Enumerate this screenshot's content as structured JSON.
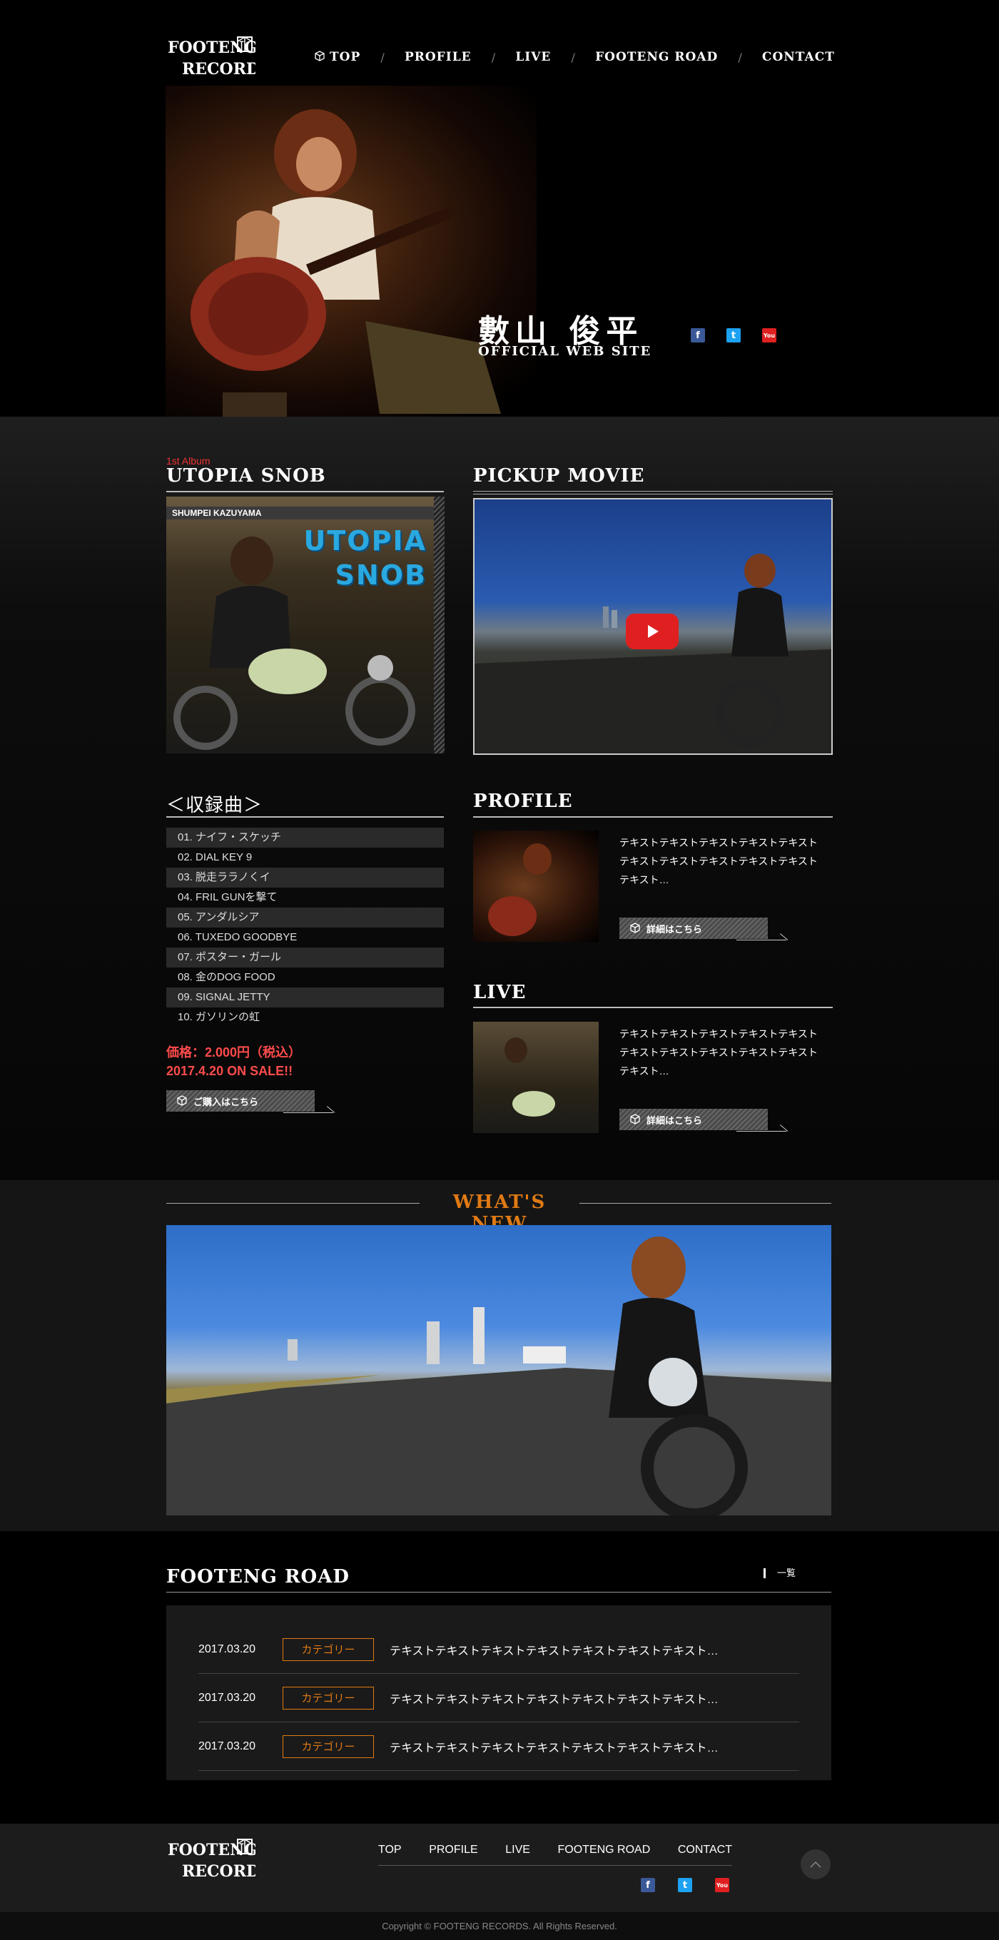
{
  "colors": {
    "accent_orange": "#e07a14",
    "price_red": "#ff4b4b",
    "album_tag_red": "#ee3333",
    "facebook": "#3b5998",
    "twitter": "#1da1f2",
    "youtube": "#e02020"
  },
  "header": {
    "logo_line1": "FOOTENG",
    "logo_line2": "RECORDS",
    "nav": [
      {
        "label": "TOP",
        "icon": "box-icon"
      },
      {
        "label": "PROFILE"
      },
      {
        "label": "LIVE"
      },
      {
        "label": "FOOTENG ROAD"
      },
      {
        "label": "CONTACT"
      }
    ],
    "separator": "/"
  },
  "hero": {
    "name": "數山 俊平",
    "subtitle": "OFFICIAL WEB SITE",
    "social": [
      {
        "name": "facebook-icon",
        "glyph": "f"
      },
      {
        "name": "twitter-icon",
        "glyph": "t"
      },
      {
        "name": "youtube-icon",
        "glyph": "You"
      }
    ]
  },
  "album": {
    "tag": "1st Album",
    "title": "UTOPIA SNOB",
    "cover_artist": "SHUMPEI KAZUYAMA",
    "cover_title_line1": "UTOPIA",
    "cover_title_line2": "SNOB",
    "tracklist_heading": "＜収録曲＞",
    "tracks": [
      "01. ナイフ・スケッチ",
      "02. DIAL KEY 9",
      "03. 脱走ララノくイ",
      "04. FRIL GUNを撃て",
      "05. アンダルシア",
      "06. TUXEDO GOODBYE",
      "07. ポスター・ガール",
      "08. 金のDOG FOOD",
      "09. SIGNAL JETTY",
      "10. ガソリンの虹"
    ],
    "price_line": "価格：2.000円（税込）",
    "release_line": "2017.4.20 ON SALE!!",
    "buy_label": "ご購入はこちら"
  },
  "movie": {
    "title": "PICKUP MOVIE"
  },
  "profile": {
    "title": "PROFILE",
    "text": "テキストテキストテキストテキストテキストテキストテキストテキストテキストテキストテキスト…",
    "button_label": "詳細はこちら"
  },
  "live": {
    "title": "LIVE",
    "text": "テキストテキストテキストテキストテキストテキストテキストテキストテキストテキストテキスト…",
    "button_label": "詳細はこちら"
  },
  "whats_new": {
    "title": "WHAT'S NEW"
  },
  "road": {
    "title": "FOOTENG ROAD",
    "all_label": "一覧",
    "rows": [
      {
        "date": "2017.03.20",
        "category": "カテゴリー",
        "text": "テキストテキストテキストテキストテキストテキストテキスト…"
      },
      {
        "date": "2017.03.20",
        "category": "カテゴリー",
        "text": "テキストテキストテキストテキストテキストテキストテキスト…"
      },
      {
        "date": "2017.03.20",
        "category": "カテゴリー",
        "text": "テキストテキストテキストテキストテキストテキストテキスト…"
      }
    ]
  },
  "footer": {
    "nav": [
      "TOP",
      "PROFILE",
      "LIVE",
      "FOOTENG ROAD",
      "CONTACT"
    ],
    "copyright": "Copyright © FOOTENG RECORDS. All Rights Reserved."
  }
}
